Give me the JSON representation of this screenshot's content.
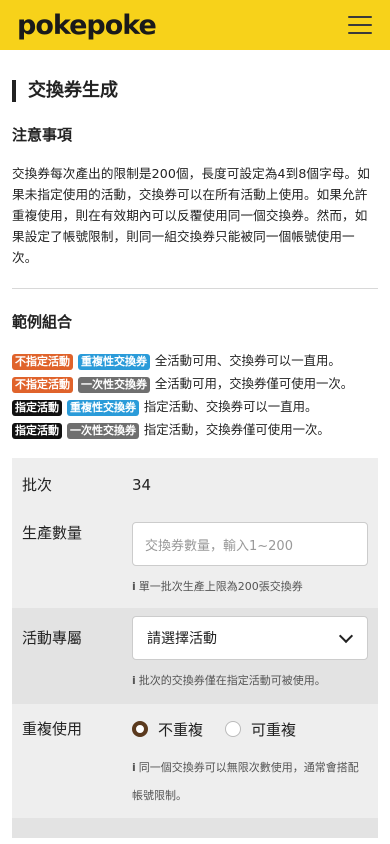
{
  "header": {
    "logo": "pokepoke",
    "menu_icon": "hamburger-menu-icon",
    "bg_color": "#f7d21a"
  },
  "page": {
    "title": "交換券生成"
  },
  "notice": {
    "heading": "注意事項",
    "text": "交換券每次產出的限制是200個，長度可設定為4到8個字母。如果未指定使用的活動，交換券可以在所有活動上使用。如果允許重複使用，則在有效期內可以反覆使用同一個交換券。然而，如果設定了帳號限制，則同一組交換券只能被同一個帳號使用一次。"
  },
  "examples": {
    "heading": "範例組合",
    "rows": [
      {
        "tag1": "不指定活動",
        "tag2": "重複性交換券",
        "text": "全活動可用、交換券可以一直用。"
      },
      {
        "tag1": "不指定活動",
        "tag2": "一次性交換券",
        "text": "全活動可用，交換券僅可使用一次。"
      },
      {
        "tag1": "指定活動",
        "tag2": "重複性交換券",
        "text": "指定活動、交換券可以一直用。"
      },
      {
        "tag1": "指定活動",
        "tag2": "一次性交換券",
        "text": "指定活動，交換券僅可使用一次。"
      }
    ]
  },
  "form": {
    "batch": {
      "label": "批次",
      "value": "34"
    },
    "quantity": {
      "label": "生產數量",
      "placeholder": "交換券數量，輸入1~200",
      "hint": "單一批次生產上限為200張交換券"
    },
    "activity": {
      "label": "活動專屬",
      "selected": "請選擇活動",
      "hint": "批次的交換券僅在指定活動可被使用。"
    },
    "repeat": {
      "label": "重複使用",
      "options": [
        "不重複",
        "可重複"
      ],
      "selected_index": 0,
      "hint": "同一個交換券可以無限次數使用，通常會搭配帳號限制。"
    }
  }
}
